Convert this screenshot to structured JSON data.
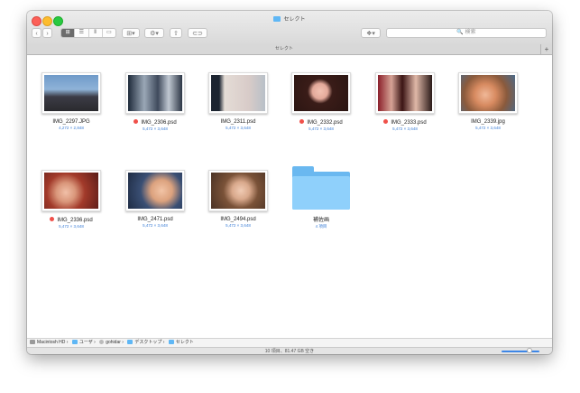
{
  "window": {
    "title": "セレクト"
  },
  "toolbar": {
    "back": "‹",
    "forward": "›",
    "view_modes": [
      "⊞",
      "☰",
      "⫴",
      "▭"
    ],
    "arrange_label": "⊞▾",
    "action_label": "⚙▾",
    "share_label": "⇧",
    "tags_label": "⊂⊃",
    "dropbox_label": "❖▾",
    "search_placeholder": "🔍 検索"
  },
  "tabbar": {
    "tab_label": "セレクト",
    "add_label": "+"
  },
  "files": [
    {
      "name": "IMG_2297.JPG",
      "info": "4,272 × 2,848",
      "tagged": false
    },
    {
      "name": "IMG_2306.psd",
      "info": "5,472 × 3,648",
      "tagged": true
    },
    {
      "name": "IMG_2311.psd",
      "info": "5,472 × 3,648",
      "tagged": false
    },
    {
      "name": "IMG_2332.psd",
      "info": "5,472 × 3,648",
      "tagged": true
    },
    {
      "name": "IMG_2333.psd",
      "info": "5,472 × 3,648",
      "tagged": true
    },
    {
      "name": "IMG_2339.jpg",
      "info": "5,472 × 3,648",
      "tagged": false
    },
    {
      "name": "IMG_2336.psd",
      "info": "5,472 × 3,648",
      "tagged": true
    },
    {
      "name": "IMG_2471.psd",
      "info": "5,472 × 3,648",
      "tagged": false
    },
    {
      "name": "IMG_2494.psd",
      "info": "5,472 × 3,648",
      "tagged": false
    },
    {
      "name": "補佐画",
      "info": "4 項目",
      "tagged": false
    }
  ],
  "colors": {
    "tag_red": "#f0504a",
    "folder_blue": "#6ab8f0",
    "accent": "#3d86e6"
  },
  "pathbar": {
    "items": [
      "Macintosh HD",
      "ユーザ",
      "gohidar",
      "デスクトップ",
      "セレクト"
    ],
    "separator": "›"
  },
  "status": {
    "text": "10 項目、81.47 GB 空き"
  }
}
